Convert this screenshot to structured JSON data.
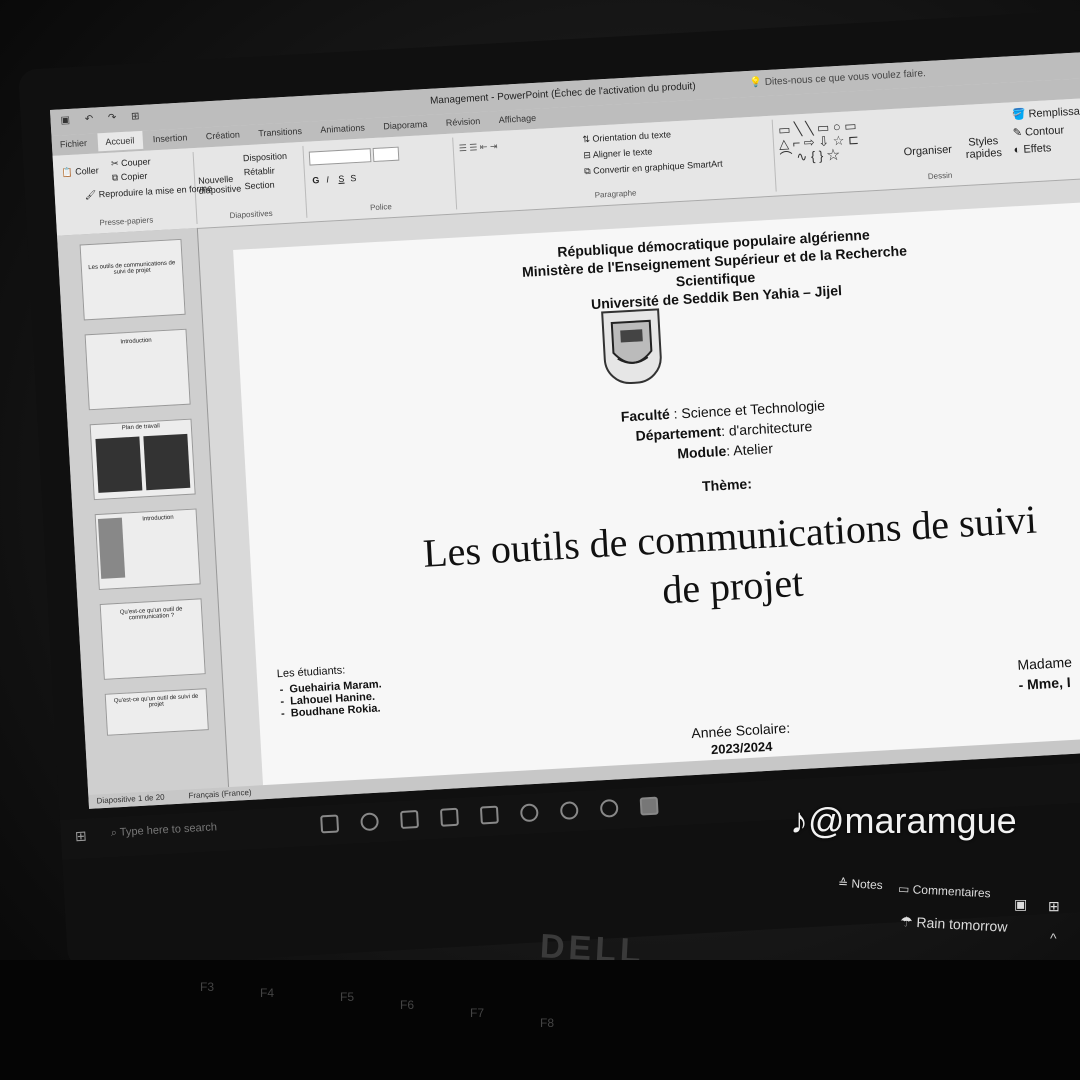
{
  "window": {
    "title": "Management - PowerPoint (Échec de l'activation du produit)",
    "tell_me": "Dites-nous ce que vous voulez faire."
  },
  "tabs": [
    "Fichier",
    "Accueil",
    "Insertion",
    "Création",
    "Transitions",
    "Animations",
    "Diaporama",
    "Révision",
    "Affichage"
  ],
  "ribbon": {
    "clipboard": {
      "cut": "Couper",
      "copy": "Copier",
      "paste": "Coller",
      "format_painter": "Reproduire la mise en forme",
      "label": "Presse-papiers"
    },
    "slides": {
      "new_slide": "Nouvelle diapositive",
      "layout": "Disposition",
      "reset": "Rétablir",
      "section": "Section",
      "label": "Diapositives"
    },
    "font": {
      "label": "Police",
      "b": "G",
      "i": "I",
      "u": "S",
      "s": "S"
    },
    "paragraph": {
      "text_direction": "Orientation du texte",
      "align_text": "Aligner le texte",
      "smartart": "Convertir en graphique SmartArt",
      "label": "Paragraphe"
    },
    "drawing": {
      "arrange": "Organiser",
      "quick_styles": "Styles rapides",
      "fill": "Remplissage",
      "outline": "Contour",
      "effects": "Effets",
      "label": "Dessin"
    }
  },
  "thumbnails": [
    {
      "num": "1",
      "text": "Les outils de communications de suivi de projet"
    },
    {
      "num": "2",
      "text": "Introduction"
    },
    {
      "num": "3",
      "text": "Plan de travail"
    },
    {
      "num": "4",
      "text": "Introduction"
    },
    {
      "num": "5",
      "text": "Qu'est-ce qu'un outil de communication ?"
    },
    {
      "num": "6",
      "text": "Qu'est-ce qu'un outil de suivi de projet"
    }
  ],
  "slide": {
    "line1": "République démocratique populaire algérienne",
    "line2": "Ministère de l'Enseignement Supérieur et de la Recherche",
    "line3": "Scientifique",
    "line4": "Université de Seddik Ben Yahia – Jijel",
    "faculty_label": "Faculté",
    "faculty_value": " : Science et Technologie",
    "dept_label": "Département",
    "dept_value": ": d'architecture",
    "module_label": "Module",
    "module_value": ": Atelier",
    "theme_label": "Thème:",
    "title_line1": "Les outils de communications de suivi",
    "title_line2": "de projet",
    "students_label": "Les étudiants:",
    "students": [
      "Guehairia Maram.",
      "Lahouel Hanine.",
      "Boudhane Rokia."
    ],
    "teacher_label": "Madame",
    "teacher_value": "- Mme, I",
    "year_label": "Année Scolaire:",
    "year_value": "2023/2024"
  },
  "statusbar": {
    "slide_count": "Diapositive 1 de 20",
    "language": "Français (France)"
  },
  "bottom": {
    "notes": "Notes",
    "comments": "Commentaires",
    "weather": "Rain tomorrow",
    "search": "Type here to search",
    "brand": "DELL"
  },
  "watermark": "@maramgue"
}
